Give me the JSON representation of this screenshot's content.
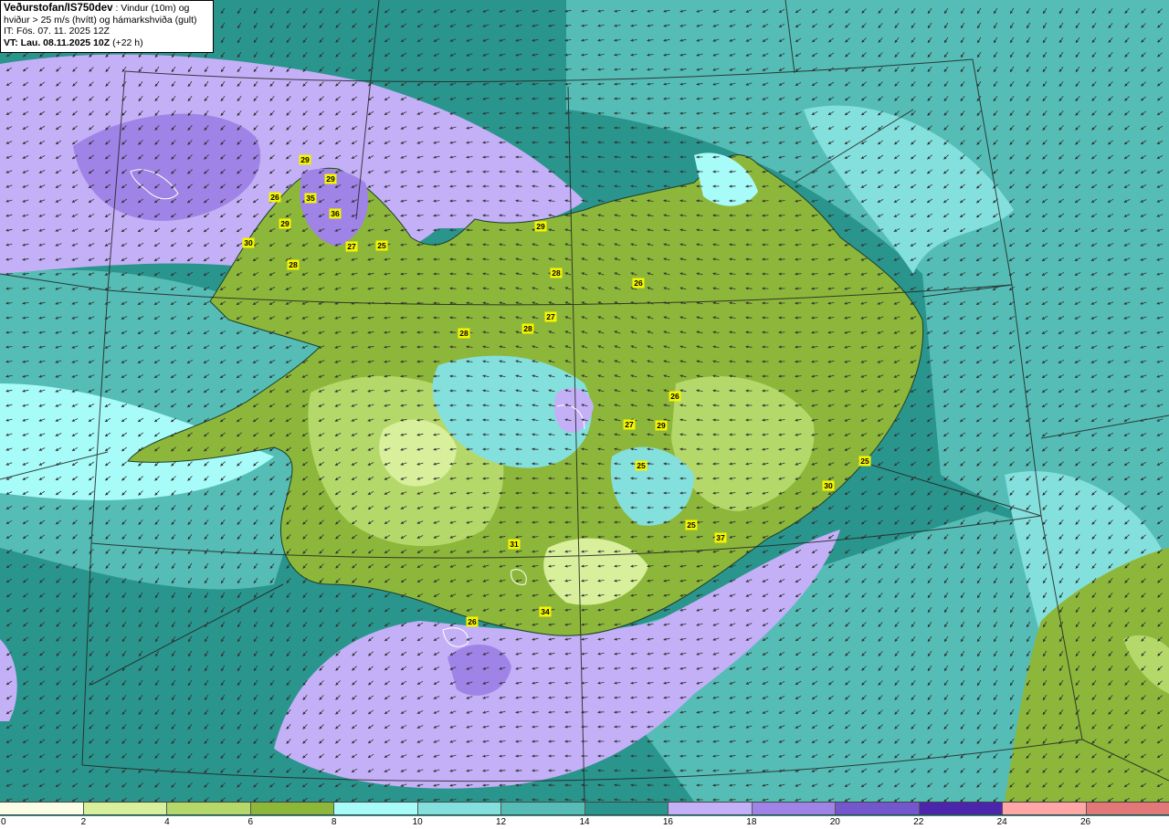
{
  "header": {
    "org": "Veðurstofan/IS750dev",
    "desc1": " : Vindur (10m) og",
    "desc2": "hviður > 25 m/s (hvítt) og hámarkshviða (gult)",
    "it_time": "IT: Fös. 07. 11. 2025 12Z",
    "vt_time": "VT: Lau. 08.11.2025 10Z",
    "lead": " (+22 h)"
  },
  "legend": {
    "colors": [
      "#fbfde6",
      "#d8ef9c",
      "#b5d86a",
      "#8db73b",
      "#a7fbf8",
      "#84e0dd",
      "#55bdb6",
      "#2a958d",
      "#c3b0f7",
      "#9f83e6",
      "#7456cd",
      "#4b26ad",
      "#ffa6a6",
      "#e27878"
    ],
    "ticks": [
      "0",
      "2",
      "4",
      "6",
      "8",
      "10",
      "12",
      "14",
      "16",
      "18",
      "20",
      "22",
      "24",
      "26"
    ]
  },
  "gust_markers": [
    {
      "value": "29"
    },
    {
      "value": "29"
    },
    {
      "value": "26"
    },
    {
      "value": "35"
    },
    {
      "value": "36"
    },
    {
      "value": "29"
    },
    {
      "value": "30"
    },
    {
      "value": "27"
    },
    {
      "value": "25"
    },
    {
      "value": "28"
    },
    {
      "value": "29"
    },
    {
      "value": "28"
    },
    {
      "value": "26"
    },
    {
      "value": "27"
    },
    {
      "value": "28"
    },
    {
      "value": "28"
    },
    {
      "value": "26"
    },
    {
      "value": "27"
    },
    {
      "value": "29"
    },
    {
      "value": "25"
    },
    {
      "value": "25"
    },
    {
      "value": "30"
    },
    {
      "value": "25"
    },
    {
      "value": "37"
    },
    {
      "value": "31"
    },
    {
      "value": "34"
    },
    {
      "value": "26"
    }
  ]
}
